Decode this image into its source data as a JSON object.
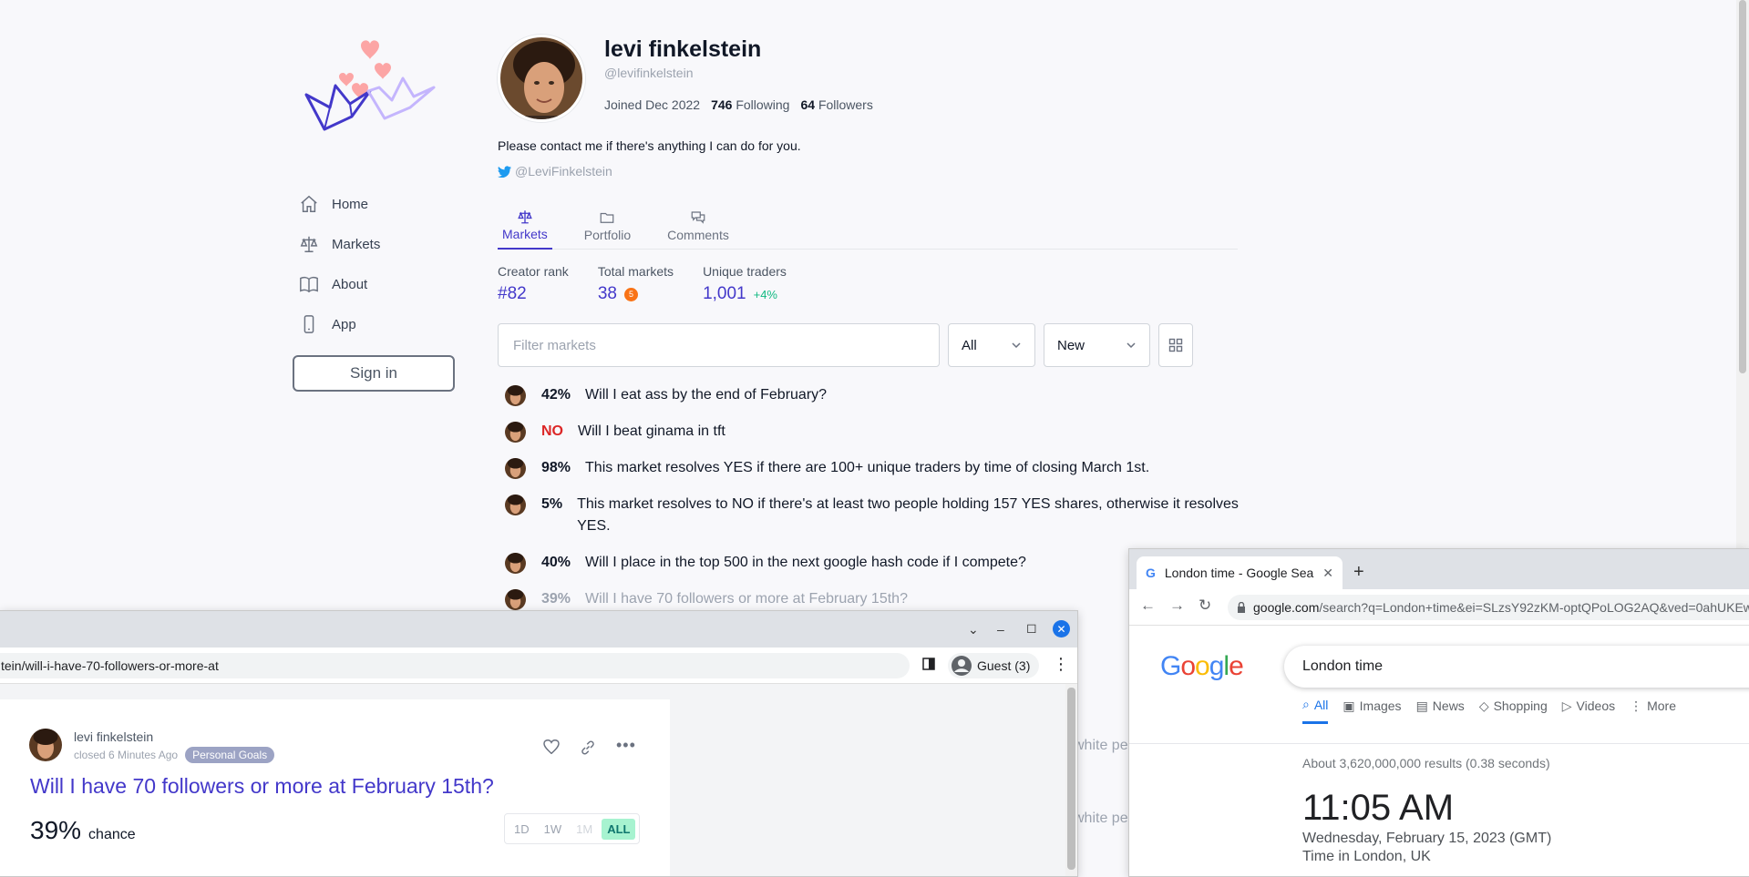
{
  "sidebar": {
    "nav": [
      {
        "label": "Home",
        "icon": "home-icon"
      },
      {
        "label": "Markets",
        "icon": "scale-icon"
      },
      {
        "label": "About",
        "icon": "book-icon"
      },
      {
        "label": "App",
        "icon": "phone-icon"
      }
    ],
    "signin_label": "Sign in"
  },
  "profile": {
    "name": "levi finkelstein",
    "handle": "@levifinkelstein",
    "joined": "Joined Dec 2022",
    "following_count": "746",
    "following_label": "Following",
    "followers_count": "64",
    "followers_label": "Followers",
    "bio": "Please contact me if there's anything I can do for you.",
    "twitter": "@LeviFinkelstein"
  },
  "tabs": [
    {
      "label": "Markets",
      "active": true
    },
    {
      "label": "Portfolio",
      "active": false
    },
    {
      "label": "Comments",
      "active": false
    }
  ],
  "kpis": {
    "creator_rank_label": "Creator rank",
    "creator_rank": "#82",
    "total_markets_label": "Total markets",
    "total_markets": "38",
    "total_markets_badge": "5",
    "unique_traders_label": "Unique traders",
    "unique_traders": "1,001",
    "unique_traders_delta": "+4%"
  },
  "filter": {
    "placeholder": "Filter markets",
    "status": "All",
    "sort": "New"
  },
  "markets": [
    {
      "prob": "42%",
      "title": "Will I eat ass by the end of February?"
    },
    {
      "prob": "NO",
      "title": "Will I beat ginama in tft"
    },
    {
      "prob": "98%",
      "title": "This market resolves YES if there are 100+ unique traders by time of closing March 1st."
    },
    {
      "prob": "5%",
      "title": "This market resolves to NO if there's at least two people holding 157 YES shares, otherwise it resolves YES."
    },
    {
      "prob": "40%",
      "title": "Will I place in the top 500 in the next google hash code if I compete?"
    },
    {
      "prob": "39%",
      "title": "Will I have 70 followers or more at February 15th?"
    }
  ],
  "bg_fragments": [
    "white pe",
    "white pe"
  ],
  "window1": {
    "url": "tein/will-i-have-70-followers-or-more-at",
    "guest_label": "Guest (3)",
    "card": {
      "author": "levi finkelstein",
      "closed": "closed 6 Minutes Ago",
      "tag": "Personal Goals",
      "question": "Will I have 70 followers or more at February 15th?",
      "chance_value": "39%",
      "chance_label": "chance",
      "ranges": [
        "1D",
        "1W",
        "1M",
        "ALL"
      ]
    }
  },
  "window2": {
    "tab_title": "London time - Google Sea",
    "url_host": "google.com",
    "url_rest": "/search?q=London+time&ei=SLzsY92zKM-optQPoLOG2AQ&ved=0ahUKEw",
    "search_value": "London time",
    "tabs": [
      {
        "label": "All",
        "active": true
      },
      {
        "label": "Images",
        "active": false
      },
      {
        "label": "News",
        "active": false
      },
      {
        "label": "Shopping",
        "active": false
      },
      {
        "label": "Videos",
        "active": false
      },
      {
        "label": "More",
        "active": false
      }
    ],
    "results_stats": "About 3,620,000,000 results (0.38 seconds)",
    "time": "11:05 AM",
    "date": "Wednesday, February 15, 2023 (GMT)",
    "location": "Time in London, UK"
  },
  "colors": {
    "accent": "#4338ca",
    "no": "#dc2626",
    "positive": "#10b981",
    "google_blue": "#1a73e8"
  }
}
